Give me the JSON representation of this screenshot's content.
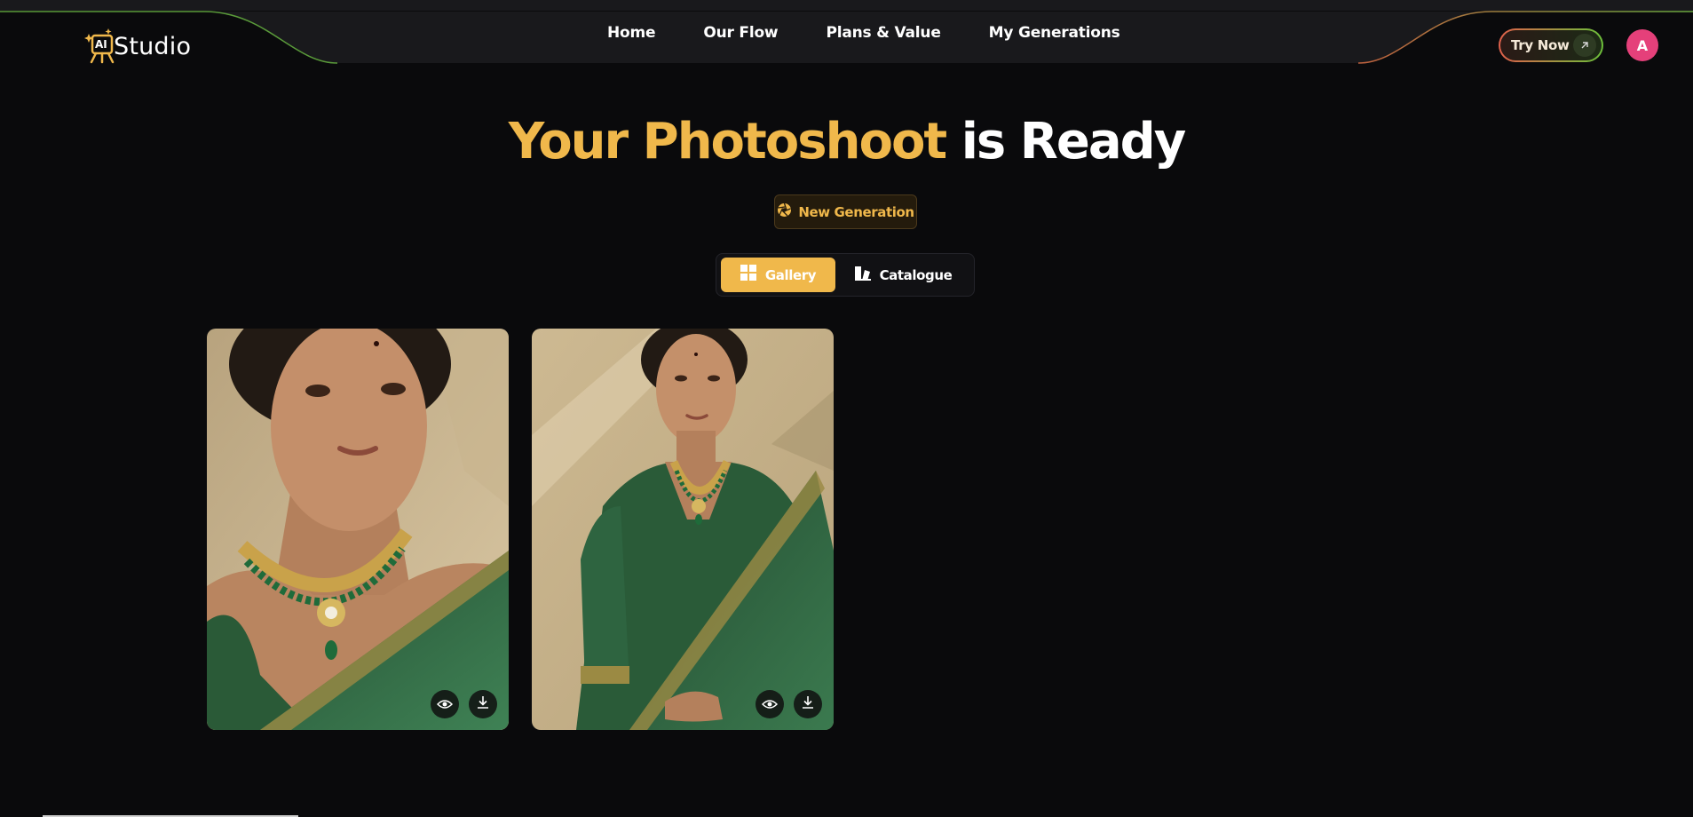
{
  "header": {
    "logo": {
      "badge": "AI",
      "text": "Studio"
    },
    "nav": [
      {
        "label": "Home"
      },
      {
        "label": "Our Flow"
      },
      {
        "label": "Plans & Value"
      },
      {
        "label": "My Generations"
      }
    ],
    "try_now_label": "Try Now",
    "avatar_initial": "A"
  },
  "hero": {
    "title_accent": "Your Photoshoot",
    "title_rest": "is Ready",
    "new_generation_label": "New Generation"
  },
  "view_toggle": {
    "gallery_label": "Gallery",
    "catalogue_label": "Catalogue",
    "active": "gallery"
  },
  "gallery": {
    "items": [
      {
        "subject": "close-up portrait, green saree, kundan necklace",
        "actions": [
          "view-icon",
          "download-icon"
        ]
      },
      {
        "subject": "half-length portrait, green saree, kundan necklace",
        "actions": [
          "view-icon",
          "download-icon"
        ]
      }
    ]
  },
  "colors": {
    "background": "#0a0a0c",
    "accent": "#f0b84b",
    "avatar": "#e5407a",
    "saree_green": "#2f6e43"
  }
}
